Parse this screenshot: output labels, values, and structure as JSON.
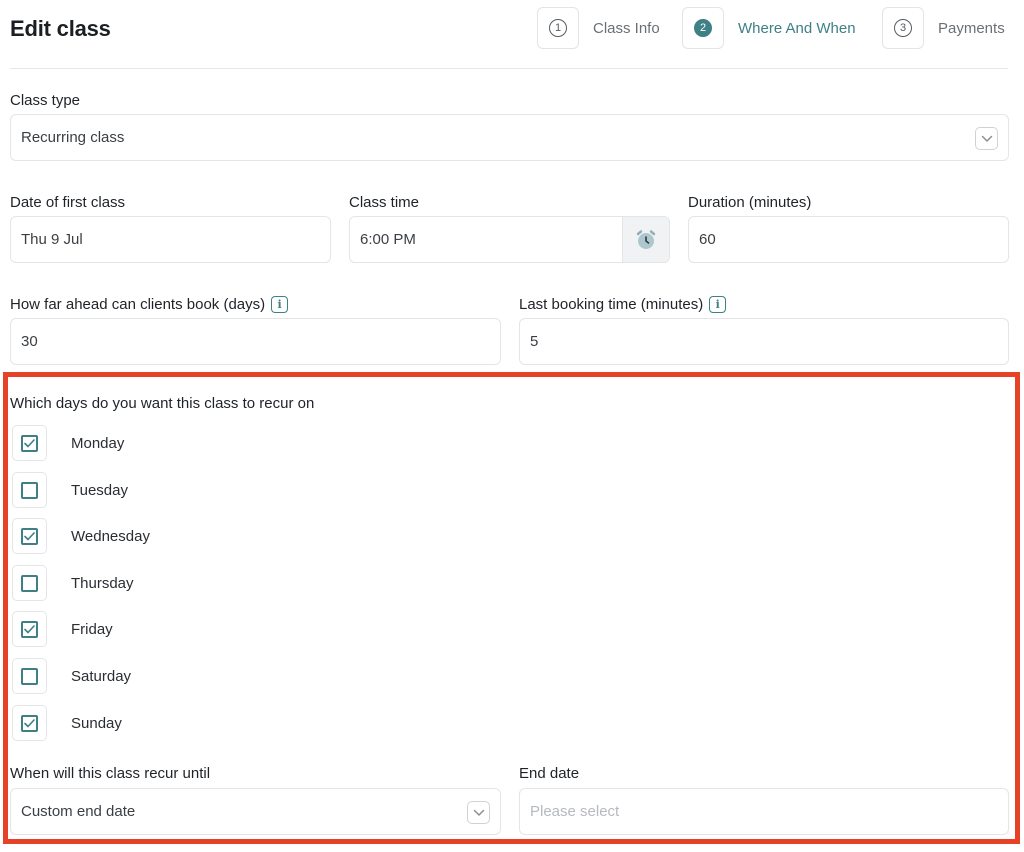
{
  "page": {
    "title": "Edit class"
  },
  "steps": [
    {
      "number": "1",
      "label": "Class Info",
      "active": false
    },
    {
      "number": "2",
      "label": "Where And When",
      "active": true
    },
    {
      "number": "3",
      "label": "Payments",
      "active": false
    }
  ],
  "class_type": {
    "label": "Class type",
    "value": "Recurring class"
  },
  "first_class_date": {
    "label": "Date of first class",
    "value": "Thu 9 Jul"
  },
  "class_time": {
    "label": "Class time",
    "value": "6:00 PM"
  },
  "duration": {
    "label": "Duration (minutes)",
    "value": "60"
  },
  "booking_ahead": {
    "label": "How far ahead can clients book (days)",
    "value": "30"
  },
  "last_booking": {
    "label": "Last booking time (minutes)",
    "value": "5"
  },
  "recur_days": {
    "label": "Which days do you want this class to recur on",
    "days": [
      {
        "label": "Monday",
        "checked": true
      },
      {
        "label": "Tuesday",
        "checked": false
      },
      {
        "label": "Wednesday",
        "checked": true
      },
      {
        "label": "Thursday",
        "checked": false
      },
      {
        "label": "Friday",
        "checked": true
      },
      {
        "label": "Saturday",
        "checked": false
      },
      {
        "label": "Sunday",
        "checked": true
      }
    ]
  },
  "recur_until": {
    "label": "When will this class recur until",
    "value": "Custom end date"
  },
  "end_date": {
    "label": "End date",
    "placeholder": "Please select"
  },
  "colors": {
    "accent": "#3f7f86",
    "highlight": "#e64227"
  },
  "icons": {
    "info": "info-icon",
    "chevron": "chevron-down-icon",
    "clock": "alarm-clock-icon",
    "check": "checkmark-icon"
  }
}
